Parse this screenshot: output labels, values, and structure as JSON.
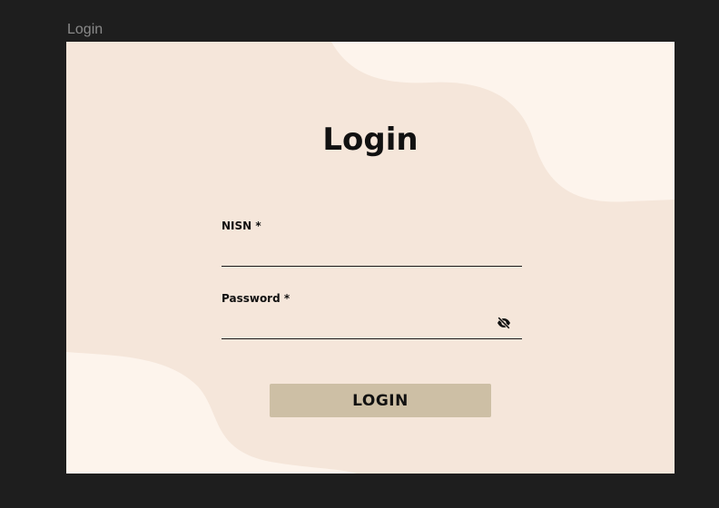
{
  "frame": {
    "label": "Login"
  },
  "login": {
    "title": "Login",
    "nisn": {
      "label": "NISN *",
      "value": "",
      "placeholder": ""
    },
    "password": {
      "label": "Password *",
      "value": "",
      "placeholder": "",
      "visibility_icon": "eye-off-icon"
    },
    "submit_label": "LOGIN"
  },
  "colors": {
    "outer_background": "#1e1e1e",
    "card_background": "#f5e6da",
    "blob_color": "#fdf4ec",
    "button_background": "#cdbfa5",
    "text": "#111111"
  }
}
